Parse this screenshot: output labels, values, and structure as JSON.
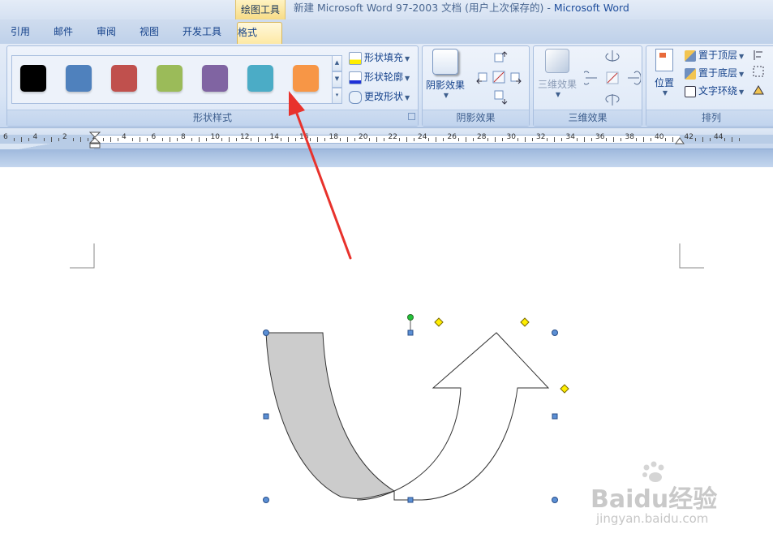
{
  "window": {
    "title_doc": "新建 Microsoft Word 97-2003 文档 (用户上次保存的)",
    "title_sep": " - ",
    "title_app": "Microsoft Word",
    "context_group": "绘图工具"
  },
  "tabs": [
    {
      "label": "引用"
    },
    {
      "label": "邮件"
    },
    {
      "label": "审阅"
    },
    {
      "label": "视图"
    },
    {
      "label": "开发工具"
    },
    {
      "label": "格式",
      "active": true
    }
  ],
  "ribbon": {
    "shape_styles": {
      "label": "形状样式",
      "swatch_colors": [
        "#000000",
        "#4f81bd",
        "#c0504d",
        "#9bbb59",
        "#8064a2",
        "#4bacc6",
        "#f79646"
      ],
      "fill_label": "形状填充",
      "outline_label": "形状轮廓",
      "change_label": "更改形状"
    },
    "shadow": {
      "label": "阴影效果",
      "button_label": "阴影效果"
    },
    "threed": {
      "label": "三维效果",
      "button_label": "三维效果"
    },
    "arrange": {
      "label": "排列",
      "position_label": "位置",
      "bring_front": "置于顶层",
      "send_back": "置于底层",
      "text_wrap": "文字环绕"
    }
  },
  "ruler": {
    "numbers": [
      "6",
      "4",
      "2",
      "2",
      "4",
      "6",
      "8",
      "10",
      "12",
      "14",
      "16",
      "18",
      "20",
      "22",
      "24",
      "26",
      "28",
      "30",
      "32",
      "34",
      "36",
      "38",
      "40",
      "42",
      "44"
    ]
  },
  "watermark": {
    "brand": "Baidu经验",
    "url": "jingyan.baidu.com"
  },
  "colors": {
    "annotation_arrow": "#e8322c",
    "shape_fill_gray": "#cccccc",
    "handle_blue": "#5b8fd4",
    "handle_yellow": "#ffee00",
    "handle_green": "#22c33a"
  }
}
